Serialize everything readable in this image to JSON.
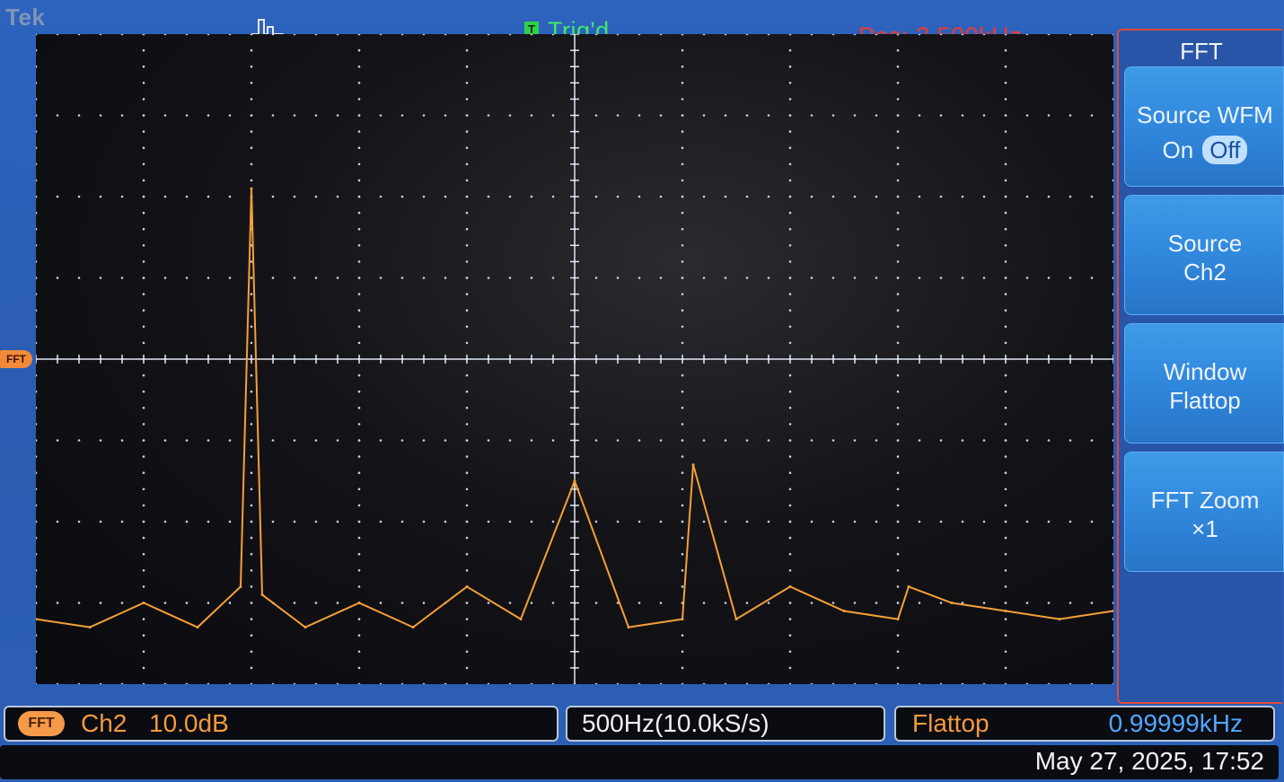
{
  "header": {
    "brand": "Tek",
    "trigger_icon": "pulse-icon",
    "trigger_badge": "T",
    "trigger_status": "Trig'd",
    "position": "Pos: 2.500kHz"
  },
  "side_menu": {
    "title": "FFT",
    "source_wfm": {
      "label": "Source WFM",
      "on": "On",
      "off": "Off",
      "selected": "Off"
    },
    "source": {
      "label": "Source",
      "value": "Ch2"
    },
    "window": {
      "label": "Window",
      "value": "Flattop"
    },
    "zoom": {
      "label": "FFT Zoom",
      "value": "×1"
    }
  },
  "ref_marker": "FFT",
  "bottom_bar": {
    "ch_badge": "FFT",
    "channel": "Ch2",
    "scale": "10.0dB",
    "span": "500Hz(10.0kS/s)",
    "window": "Flattop",
    "frequency": "0.99999kHz",
    "datetime": "May 27, 2025, 17:52"
  },
  "colors": {
    "trace": "#f4a038",
    "trig_status": "#3fe86a",
    "position": "#ee3a2f",
    "freq_readout": "#52a6ff",
    "menu_border": "#e24a3a"
  },
  "chart_data": {
    "type": "line",
    "title": "",
    "xlabel": "",
    "ylabel": "",
    "x_unit": "kHz",
    "y_unit": "dB",
    "x": [
      0.0,
      0.25,
      0.5,
      0.75,
      0.95,
      1.0,
      1.05,
      1.25,
      1.5,
      1.75,
      2.0,
      2.25,
      2.5,
      2.75,
      3.0,
      3.05,
      3.25,
      3.5,
      3.75,
      4.0,
      4.05,
      4.25,
      4.5,
      4.75,
      5.0
    ],
    "values": [
      -62,
      -63,
      -60,
      -63,
      -58,
      -9,
      -59,
      -63,
      -60,
      -63,
      -58,
      -62,
      -45,
      -63,
      -62,
      -43,
      -62,
      -58,
      -61,
      -62,
      -58,
      -60,
      -61,
      -62,
      -61
    ],
    "ylim": [
      -70,
      10
    ],
    "xlim": [
      0,
      5.0
    ],
    "grid": true
  }
}
